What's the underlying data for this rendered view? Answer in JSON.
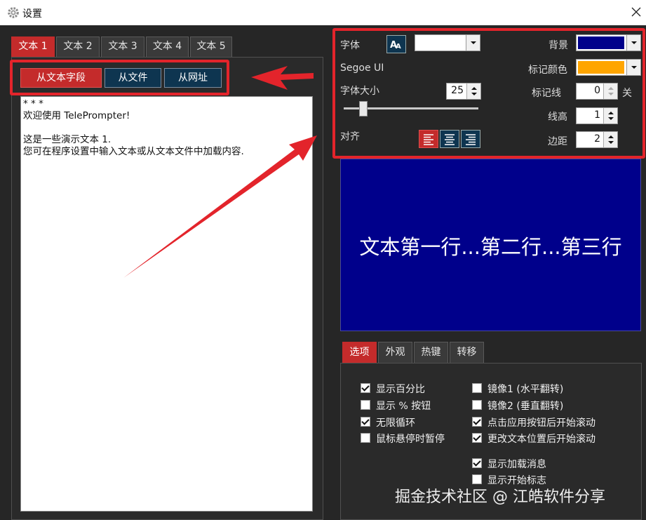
{
  "window": {
    "title": "设置",
    "icons": {
      "app": "gear-icon",
      "close": "close-icon"
    }
  },
  "text_tabs": [
    "文本 1",
    "文本 2",
    "文本 3",
    "文本 4",
    "文本 5"
  ],
  "source_buttons": {
    "from_field": "从文本字段",
    "from_file": "从文件",
    "from_url": "从网址"
  },
  "editor_lines": [
    "* * *",
    "欢迎使用 TelePrompter!",
    "",
    "这是一些演示文本 1.",
    "您可在程序设置中输入文本或从文本文件中加载内容."
  ],
  "settings": {
    "font_label": "字体",
    "font_name": "Segoe UI",
    "font_size_label": "字体大小",
    "font_size_value": "25",
    "font_size_slider_level": 0.12,
    "align_label": "对齐",
    "background_label": "背景",
    "background_color": "#00008b",
    "marker_color_label": "标记颜色",
    "marker_color": "#ffa500",
    "marker_line_label": "标记线",
    "marker_line_value": "0",
    "marker_line_suffix": "关",
    "line_height_label": "线高",
    "line_height_value": "1",
    "margin_label": "边距",
    "margin_value": "2"
  },
  "preview_text": "文本第一行...第二行...第三行",
  "bottom_tabs": [
    "选项",
    "外观",
    "热键",
    "转移"
  ],
  "options_left": [
    {
      "label": "显示百分比",
      "checked": true
    },
    {
      "label": "显示 % 按钮",
      "checked": false
    },
    {
      "label": "无限循环",
      "checked": true
    },
    {
      "label": "鼠标悬停时暂停",
      "checked": false
    }
  ],
  "options_right": [
    {
      "label": "镜像1 (水平翻转)",
      "checked": false
    },
    {
      "label": "镜像2 (垂直翻转)",
      "checked": false
    },
    {
      "label": "点击应用按钮后开始滚动",
      "checked": true
    },
    {
      "label": "更改文本位置后开始滚动",
      "checked": true
    },
    {
      "label": "显示加载消息",
      "checked": true
    },
    {
      "label": "显示开始标志",
      "checked": false
    }
  ],
  "watermark": "掘金技术社区 @ 江皓软件分享",
  "colors": {
    "accent_red": "#c42b2b",
    "annotation_red": "#e3242b",
    "button_blue": "#0e3550",
    "panel": "#262626"
  }
}
